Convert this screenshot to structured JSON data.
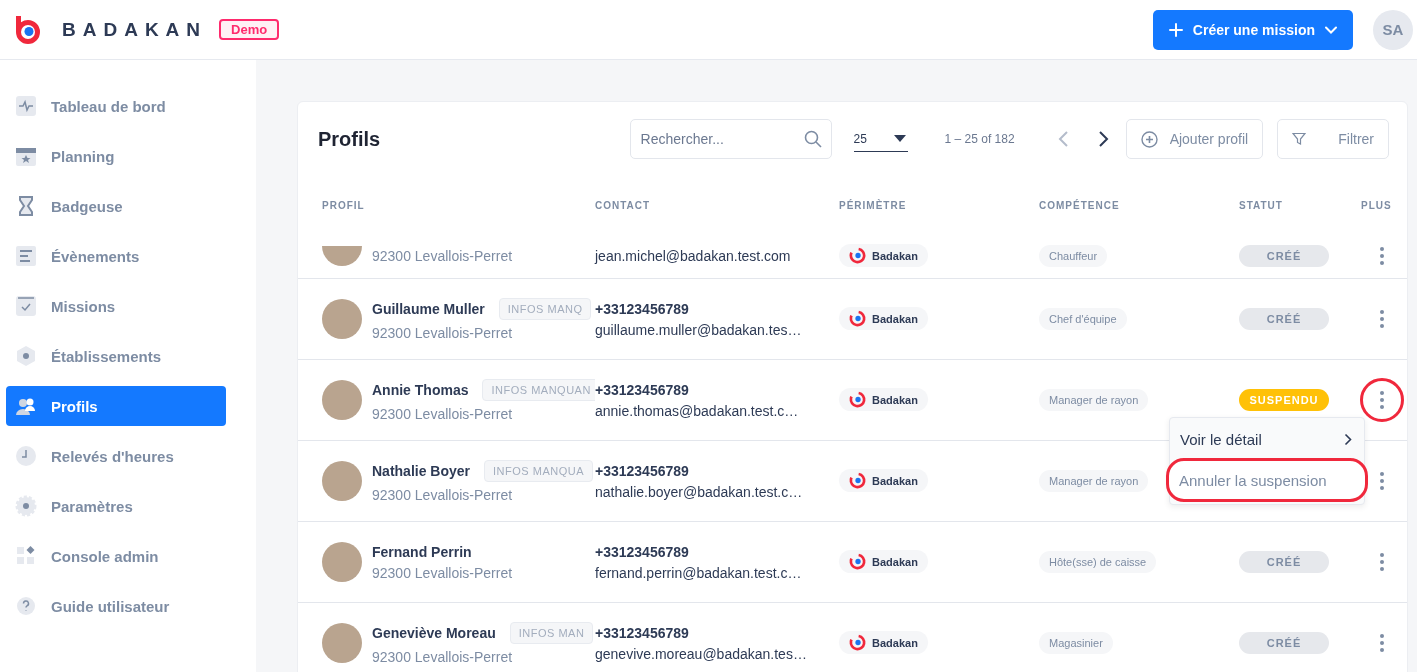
{
  "header": {
    "brand": "BADAKAN",
    "badge": "Demo",
    "create_button": "Créer une mission",
    "avatar": "SA"
  },
  "sidebar": {
    "items": [
      {
        "label": "Tableau de bord",
        "selected": false
      },
      {
        "label": "Planning",
        "selected": false
      },
      {
        "label": "Badgeuse",
        "selected": false
      },
      {
        "label": "Évènements",
        "selected": false
      },
      {
        "label": "Missions",
        "selected": false
      },
      {
        "label": "Établissements",
        "selected": false
      },
      {
        "label": "Profils",
        "selected": true
      },
      {
        "label": "Relevés d'heures",
        "selected": false
      },
      {
        "label": "Paramètres",
        "selected": false
      },
      {
        "label": "Console admin",
        "selected": false
      },
      {
        "label": "Guide utilisateur",
        "selected": false
      }
    ]
  },
  "card": {
    "title": "Profils",
    "search": {
      "placeholder": "Rechercher..."
    },
    "per_page": "25",
    "range": "1 – 25 of 182",
    "add_button": "Ajouter profil",
    "filter_button": "Filtrer"
  },
  "table": {
    "columns": [
      "PROFIL",
      "CONTACT",
      "PÉRIMÈTRE",
      "COMPÉTENCE",
      "STATUT",
      "PLUS"
    ],
    "rows": [
      {
        "city": "92300 Levallois-Perret",
        "email": "jean.michel@badakan.test.com",
        "perimeter": "Badakan",
        "competence": "Chauffeur",
        "status": {
          "label": "CRÉÉ",
          "kind": "created"
        },
        "highlighted": false
      },
      {
        "name": "Guillaume Muller",
        "missing_info": "INFOS MANQ",
        "city": "92300 Levallois-Perret",
        "phone": "+33123456789",
        "email": "guillaume.muller@badakan.tes…",
        "perimeter": "Badakan",
        "competence": "Chef d'équipe",
        "status": {
          "label": "CRÉÉ",
          "kind": "created"
        },
        "highlighted": false
      },
      {
        "name": "Annie Thomas",
        "missing_info": "INFOS MANQUAN",
        "city": "92300 Levallois-Perret",
        "phone": "+33123456789",
        "email": "annie.thomas@badakan.test.c…",
        "perimeter": "Badakan",
        "competence": "Manager de rayon",
        "status": {
          "label": "SUSPENDU",
          "kind": "suspended"
        },
        "highlighted": true,
        "menu_open": true
      },
      {
        "name": "Nathalie Boyer",
        "missing_info": "INFOS MANQUA",
        "city": "92300 Levallois-Perret",
        "phone": "+33123456789",
        "email": "nathalie.boyer@badakan.test.c…",
        "perimeter": "Badakan",
        "competence": "Manager de rayon",
        "highlighted": false
      },
      {
        "name": "Fernand Perrin",
        "city": "92300 Levallois-Perret",
        "phone": "+33123456789",
        "email": "fernand.perrin@badakan.test.c…",
        "perimeter": "Badakan",
        "competence": "Hôte(sse) de caisse",
        "status": {
          "label": "CRÉÉ",
          "kind": "created"
        },
        "highlighted": false
      },
      {
        "name": "Geneviève Moreau",
        "missing_info": "INFOS MAN",
        "city": "92300 Levallois-Perret",
        "phone": "+33123456789",
        "email": "genevive.moreau@badakan.tes…",
        "perimeter": "Badakan",
        "competence": "Magasinier",
        "status": {
          "label": "CRÉÉ",
          "kind": "created"
        },
        "highlighted": false
      }
    ]
  },
  "context_menu": {
    "items": [
      {
        "label": "Voir le détail",
        "kind": "link",
        "highlighted": false
      },
      {
        "label": "Annuler la suspension",
        "kind": "action",
        "highlighted": true
      }
    ]
  }
}
